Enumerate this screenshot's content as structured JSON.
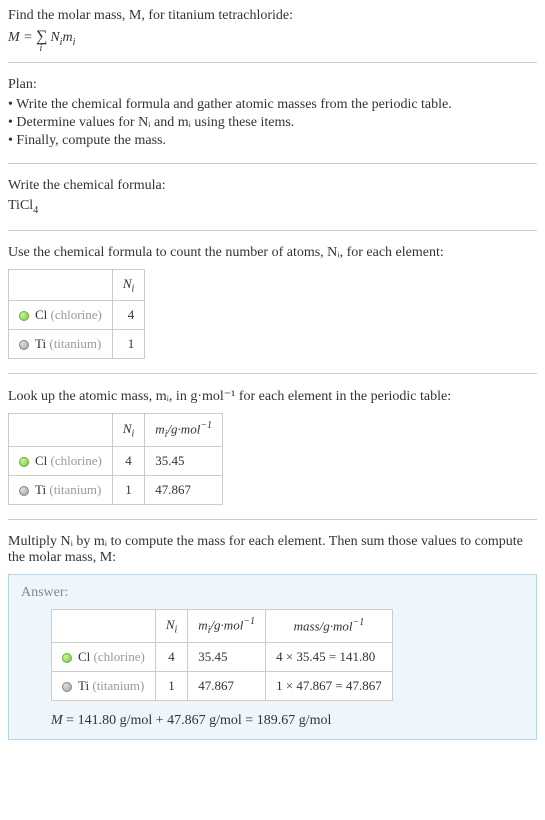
{
  "intro": {
    "line1": "Find the molar mass, M, for titanium tetrachloride:",
    "formula_M": "M",
    "formula_eq": " = ",
    "formula_sum": "∑",
    "formula_sub": "i",
    "formula_rest": " Nᵢmᵢ"
  },
  "plan": {
    "title": "Plan:",
    "items": [
      "• Write the chemical formula and gather atomic masses from the periodic table.",
      "• Determine values for Nᵢ and mᵢ using these items.",
      "• Finally, compute the mass."
    ]
  },
  "step1": {
    "title": "Write the chemical formula:",
    "formula_base": "TiCl",
    "formula_sub": "4"
  },
  "step2": {
    "title": "Use the chemical formula to count the number of atoms, Nᵢ, for each element:",
    "headers": {
      "col1": "",
      "col2": "Nᵢ"
    },
    "rows": [
      {
        "symbol": "Cl",
        "name": "(chlorine)",
        "n": "4",
        "dot": "cl"
      },
      {
        "symbol": "Ti",
        "name": "(titanium)",
        "n": "1",
        "dot": "ti"
      }
    ]
  },
  "step3": {
    "title": "Look up the atomic mass, mᵢ, in g·mol⁻¹ for each element in the periodic table:",
    "headers": {
      "col1": "",
      "col2": "Nᵢ",
      "col3": "mᵢ/g·mol⁻¹"
    },
    "rows": [
      {
        "symbol": "Cl",
        "name": "(chlorine)",
        "n": "4",
        "m": "35.45",
        "dot": "cl"
      },
      {
        "symbol": "Ti",
        "name": "(titanium)",
        "n": "1",
        "m": "47.867",
        "dot": "ti"
      }
    ]
  },
  "step4": {
    "title": "Multiply Nᵢ by mᵢ to compute the mass for each element. Then sum those values to compute the molar mass, M:"
  },
  "answer": {
    "label": "Answer:",
    "headers": {
      "col1": "",
      "col2": "Nᵢ",
      "col3": "mᵢ/g·mol⁻¹",
      "col4": "mass/g·mol⁻¹"
    },
    "rows": [
      {
        "symbol": "Cl",
        "name": "(chlorine)",
        "n": "4",
        "m": "35.45",
        "mass": "4 × 35.45 = 141.80",
        "dot": "cl"
      },
      {
        "symbol": "Ti",
        "name": "(titanium)",
        "n": "1",
        "m": "47.867",
        "mass": "1 × 47.867 = 47.867",
        "dot": "ti"
      }
    ],
    "result": "M = 141.80 g/mol + 47.867 g/mol = 189.67 g/mol"
  }
}
